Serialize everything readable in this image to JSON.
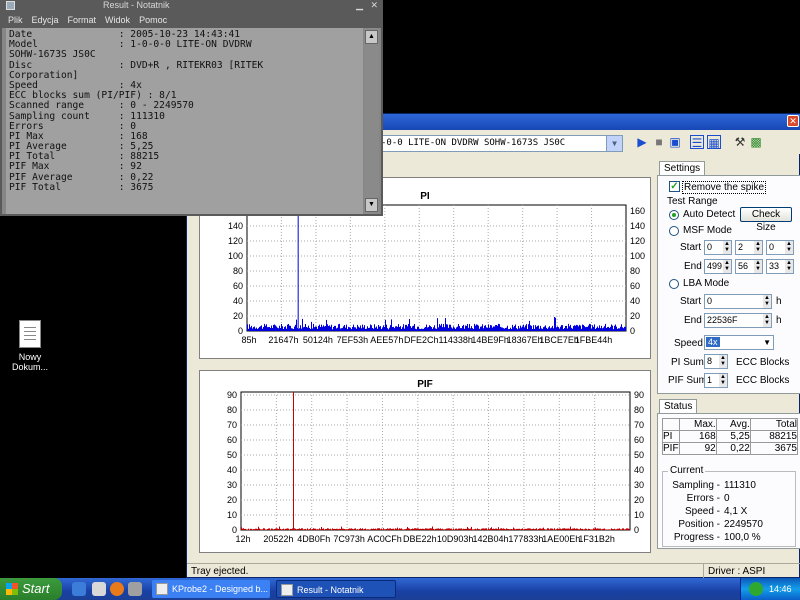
{
  "desktop": {
    "icon_label_1": "Nowy",
    "icon_label_2": "Dokum..."
  },
  "notepad": {
    "title": "Result - Notatnik",
    "menu": [
      "Plik",
      "Edycja",
      "Format",
      "Widok",
      "Pomoc"
    ],
    "lines": [
      "Date               : 2005-10-23 14:43:41",
      "Model              : 1-0-0-0 LITE-ON DVDRW",
      "SOHW-1673S JS0C",
      "Disc               : DVD+R , RITEKR03 [RITEK",
      "Corporation]",
      "Speed              : 4x",
      "ECC blocks sum (PI/PIF) : 8/1",
      "Scanned range      : 0 - 2249570",
      "Sampling count     : 111310",
      "Errors             : 0",
      "PI Max             : 168",
      "PI Average         : 5,25",
      "PI Total           : 88215",
      "PIF Max            : 92",
      "PIF Average        : 0,22",
      "PIF Total          : 3675"
    ]
  },
  "kprobe": {
    "drive": "-0-0 LITE-ON DVDRW SOHW-1673S JS0C",
    "status_text": "Tray ejected.",
    "driver_text": "Driver : ASPI"
  },
  "settings": {
    "tab_label": "Settings",
    "remove_spike": "Remove the spike",
    "test_range": "Test Range",
    "auto_detect": "Auto Detect",
    "check_size": "Check Size",
    "msf_mode": "MSF Mode",
    "start_label": "Start",
    "end_label": "End",
    "msf_start": [
      "0",
      "2",
      "0"
    ],
    "msf_end": [
      "499",
      "56",
      "33"
    ],
    "lba_mode": "LBA Mode",
    "lba_start": "0",
    "lba_end": "22536F",
    "h": "h",
    "speed_label": "Speed",
    "speed_value": "4x",
    "pi_sum_label": "PI Sum",
    "pi_sum_value": "8",
    "pif_sum_label": "PIF Sum",
    "pif_sum_value": "1",
    "ecc_blocks": "ECC Blocks"
  },
  "status": {
    "tab_label": "Status",
    "headers": [
      "Max.",
      "Avg.",
      "Total"
    ],
    "rows": [
      {
        "name": "PI",
        "max": "168",
        "avg": "5,25",
        "total": "88215"
      },
      {
        "name": "PIF",
        "max": "92",
        "avg": "0,22",
        "total": "3675"
      }
    ],
    "current_label": "Current",
    "current": [
      {
        "label": "Sampling -",
        "value": "111310"
      },
      {
        "label": "Errors -",
        "value": "0"
      },
      {
        "label": "Speed -",
        "value": "4,1  X"
      },
      {
        "label": "Position -",
        "value": "2249570"
      },
      {
        "label": "Progress -",
        "value": "100,0 %"
      }
    ]
  },
  "taskbar": {
    "start": "Start",
    "tasks": [
      "KProbe2 - Designed b...",
      "Result - Notatnik"
    ],
    "clock": "14:46"
  },
  "chart_data": [
    {
      "type": "bar",
      "title": "PI",
      "ylim": [
        0,
        168
      ],
      "y_ticks_left": [
        0,
        20,
        40,
        60,
        80,
        100,
        120,
        140
      ],
      "y_ticks_right": [
        0,
        20,
        40,
        60,
        80,
        100,
        120,
        140,
        160
      ],
      "x_tick_labels": [
        "85h",
        "21647h",
        "50124h",
        "7EF53h",
        "AEE57h",
        "DFE2Ch",
        "114338h",
        "14BE9Fh",
        "18367Eh",
        "1BCE7Eh",
        "1FBE44h"
      ],
      "baseline_level": 8,
      "spike": {
        "x_fraction": 0.135,
        "value": 168
      },
      "colors": {
        "bars": "#0000e0"
      }
    },
    {
      "type": "bar",
      "title": "PIF",
      "ylim": [
        0,
        92
      ],
      "y_ticks_left": [
        0,
        10,
        20,
        30,
        40,
        50,
        60,
        70,
        80,
        90
      ],
      "y_ticks_right": [
        0,
        10,
        20,
        30,
        40,
        50,
        60,
        70,
        80,
        90
      ],
      "x_tick_labels": [
        "12h",
        "20522h",
        "4DB0Fh",
        "7C973h",
        "AC0CFh",
        "DBE22h",
        "10D903h",
        "142B04h",
        "177833h",
        "1AE00Eh",
        "1F31B2h"
      ],
      "baseline_level": 1,
      "spike": {
        "x_fraction": 0.135,
        "value": 92
      },
      "colors": {
        "bars": "#c00000"
      }
    }
  ]
}
